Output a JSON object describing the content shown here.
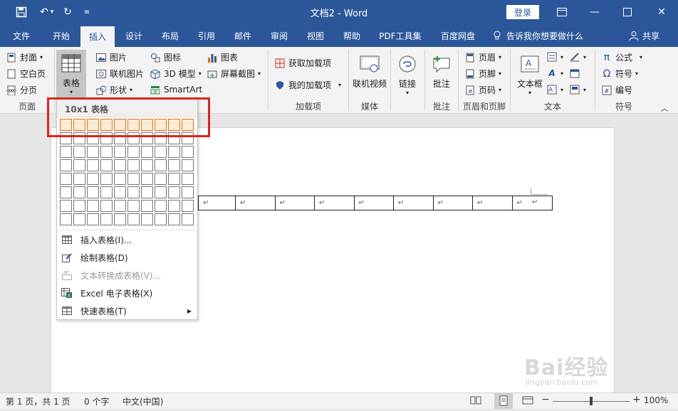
{
  "titlebar": {
    "title": "文档2 - Word",
    "login_label": "登录"
  },
  "tabs": [
    {
      "label": "文件"
    },
    {
      "label": "开始"
    },
    {
      "label": "插入"
    },
    {
      "label": "设计"
    },
    {
      "label": "布局"
    },
    {
      "label": "引用"
    },
    {
      "label": "邮件"
    },
    {
      "label": "审阅"
    },
    {
      "label": "视图"
    },
    {
      "label": "帮助"
    },
    {
      "label": "PDF工具集"
    },
    {
      "label": "百度网盘"
    }
  ],
  "active_tab": "插入",
  "tell_me": "告诉我你想要做什么",
  "share_label": "共享",
  "ribbon": {
    "page": {
      "items": [
        "封面",
        "空白页",
        "分页"
      ],
      "group_label": "页面"
    },
    "table": {
      "label": "表格"
    },
    "illustrations": {
      "items": [
        "图片",
        "联机图片",
        "形状",
        "图标",
        "3D 模型",
        "SmartArt",
        "图表",
        "屏幕截图"
      ]
    },
    "addins": {
      "items": [
        "获取加载项",
        "我的加载项"
      ],
      "group_label": "加载项"
    },
    "media": {
      "label": "联机视频",
      "group_label": "媒体"
    },
    "links": {
      "label": "链接"
    },
    "comments": {
      "label": "批注",
      "group_label": "批注"
    },
    "header_footer": {
      "items": [
        "页眉",
        "页脚",
        "页码"
      ],
      "group_label": "页眉和页脚"
    },
    "text": {
      "textbox_label": "文本框",
      "group_label": "文本"
    },
    "symbols": {
      "items": [
        "公式",
        "符号",
        "编号"
      ],
      "group_label": "符号"
    }
  },
  "table_dropdown": {
    "header": "10x1 表格",
    "grid_cols": 10,
    "grid_rows": 8,
    "selected_cols": 10,
    "selected_rows": 1,
    "items": [
      {
        "label": "插入表格(I)...",
        "enabled": true
      },
      {
        "label": "绘制表格(D)",
        "enabled": true
      },
      {
        "label": "文本转换成表格(V)...",
        "enabled": false
      },
      {
        "label": "Excel 电子表格(X)",
        "enabled": true
      },
      {
        "label": "快速表格(T)",
        "enabled": true
      }
    ]
  },
  "document": {
    "cell_mark": "↵",
    "columns": 10
  },
  "statusbar": {
    "page": "第 1 页，共 1 页",
    "words": "0 个字",
    "language": "中文(中国)",
    "zoom": "100%"
  },
  "watermark": {
    "text": "Bai经验",
    "sub": "jingyan.baidu.com"
  },
  "colors": {
    "brand": "#2b579a",
    "highlight_border": "#d9261c",
    "grid_select": "#e46c0a"
  }
}
